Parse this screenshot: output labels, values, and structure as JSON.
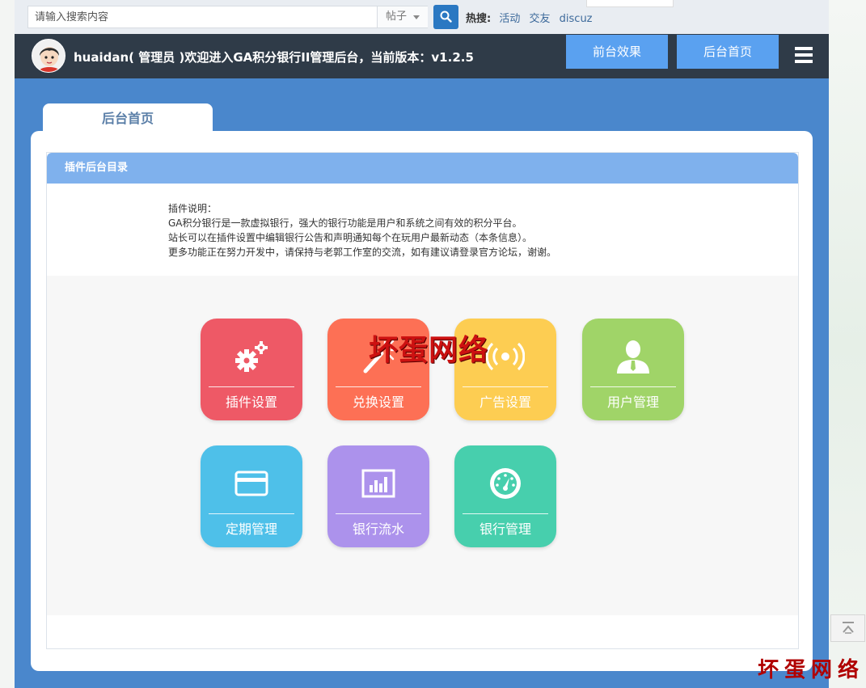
{
  "search": {
    "placeholder": "请输入搜索内容",
    "type_value": "帖子",
    "hot_label": "热搜:",
    "hot_links": [
      "活动",
      "交友",
      "discuz"
    ]
  },
  "header": {
    "welcome": "huaidan( 管理员 )欢迎进入GA积分银行II管理后台，当前版本：v1.2.5",
    "front_button": "前台效果",
    "back_button": "后台首页"
  },
  "tab": {
    "label": "后台首页"
  },
  "panel": {
    "title": "插件后台目录",
    "description": [
      "插件说明：",
      "GA积分银行是一款虚拟银行，强大的银行功能是用户和系统之间有效的积分平台。",
      "站长可以在插件设置中编辑银行公告和声明通知每个在玩用户最新动态（本条信息）。",
      "更多功能正在努力开发中，请保持与老郭工作室的交流，如有建议请登录官方论坛，谢谢。"
    ]
  },
  "tiles": [
    {
      "label": "插件设置",
      "icon": "gears-icon",
      "color": "#ee5966"
    },
    {
      "label": "兑换设置",
      "icon": "magic-wand-icon",
      "color": "#fd7055"
    },
    {
      "label": "广告设置",
      "icon": "broadcast-icon",
      "color": "#fdcd52"
    },
    {
      "label": "用户管理",
      "icon": "user-icon",
      "color": "#a0d468"
    },
    {
      "label": "定期管理",
      "icon": "credit-card-icon",
      "color": "#4ec0e9"
    },
    {
      "label": "银行流水",
      "icon": "bar-chart-icon",
      "color": "#ac92ec"
    },
    {
      "label": "银行管理",
      "icon": "dashboard-icon",
      "color": "#47cfad"
    }
  ],
  "watermark": "坏蛋网络",
  "corner_watermark": "坏蛋网络"
}
